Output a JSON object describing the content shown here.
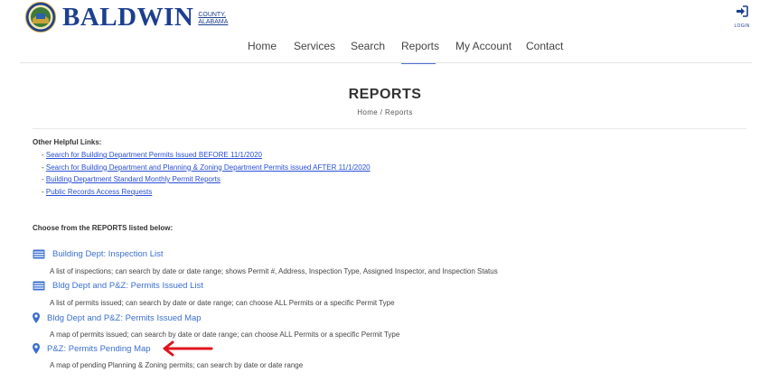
{
  "header": {
    "brand_name": "BALDWIN",
    "brand_sub_line1": "COUNTY,",
    "brand_sub_line2": "ALABAMA",
    "login_label": "LOGIN",
    "nav": [
      {
        "label": "Home"
      },
      {
        "label": "Services"
      },
      {
        "label": "Search"
      },
      {
        "label": "Reports",
        "active": true
      },
      {
        "label": "My Account"
      },
      {
        "label": "Contact"
      }
    ]
  },
  "page": {
    "title": "REPORTS",
    "breadcrumb": "Home / Reports"
  },
  "helpful": {
    "title": "Other Helpful Links:",
    "links": [
      {
        "bullet": "- ",
        "label": "Search for Building Department Permits Issued BEFORE 11/1/2020"
      },
      {
        "bullet": "- ",
        "label": "Search for Building Department and Planning & Zoning Department Permits issued AFTER 11/1/2020"
      },
      {
        "bullet": "- ",
        "label": "Building Department Standard Monthly Permit Reports"
      },
      {
        "bullet": "- ",
        "label": "Public Records Access Requests"
      }
    ]
  },
  "reports": {
    "intro": "Choose from the REPORTS listed below:",
    "items": [
      {
        "icon": "list-icon",
        "label": "Building Dept: Inspection List",
        "description": "A list of inspections; can search by date or date range; shows Permit #, Address, Inspection Type, Assigned Inspector, and Inspection Status"
      },
      {
        "icon": "list-icon",
        "label": "Bldg Dept and P&Z: Permits Issued List",
        "description": "A list of permits issued; can search by date or date range; can choose ALL Permits or a specific Permit Type"
      },
      {
        "icon": "map-pin-icon",
        "label": "Bldg Dept and P&Z: Permits Issued Map",
        "description": "A map of permits issued; can search by date or date range; can choose ALL Permits or a specific Permit Type"
      },
      {
        "icon": "map-pin-icon",
        "label": "P&Z: Permits Pending Map",
        "description": "A map of pending Planning & Zoning permits; can search by date or date range"
      }
    ]
  },
  "colors": {
    "brand": "#1d3f8f",
    "link": "#2a4fd6",
    "report_link": "#3b6fcf",
    "nav_active_underline": "#4f6fd6",
    "annotation_arrow": "#e0141e"
  }
}
